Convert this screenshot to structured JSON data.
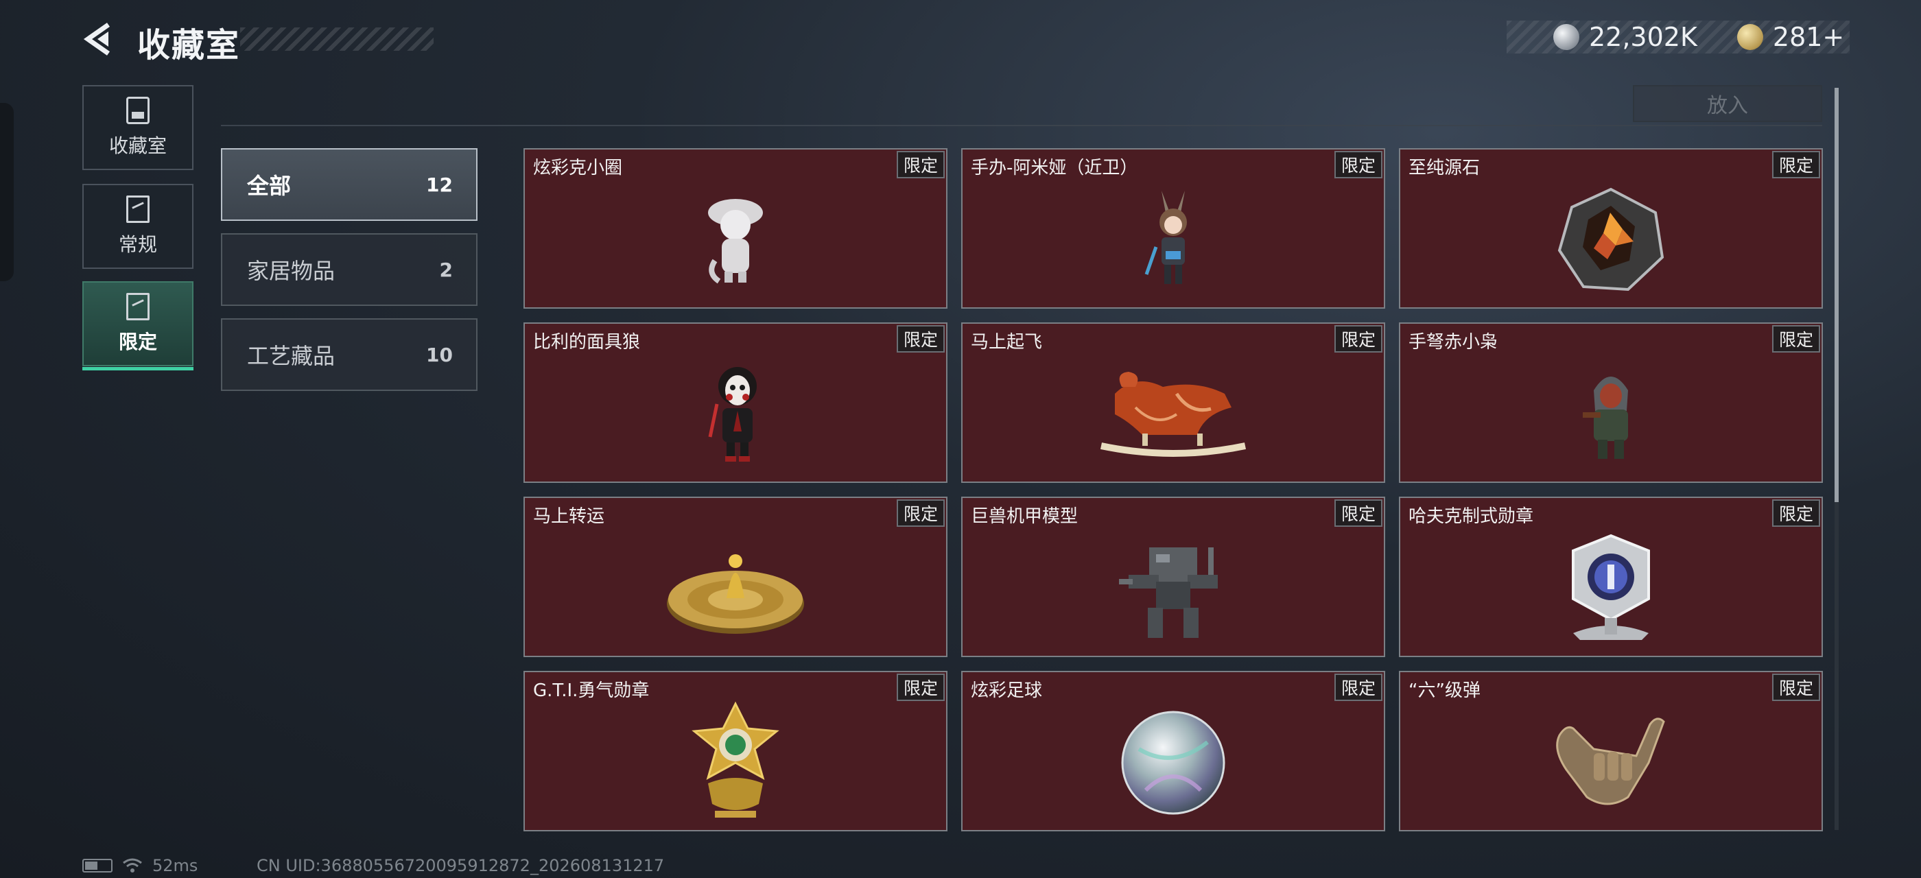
{
  "header": {
    "title": "收藏室",
    "currency_silver": "22,302K",
    "currency_gold": "281+"
  },
  "side_nav": [
    {
      "label": "收藏室",
      "icon": "collection-cabinet-icon",
      "active": false
    },
    {
      "label": "常规",
      "icon": "regular-frame-icon",
      "active": false
    },
    {
      "label": "限定",
      "icon": "limited-frame-icon",
      "active": true
    }
  ],
  "toolbar": {
    "place_button_label": "放入"
  },
  "categories": [
    {
      "label": "全部",
      "count": "12",
      "active": true
    },
    {
      "label": "家居物品",
      "count": "2",
      "active": false
    },
    {
      "label": "工艺藏品",
      "count": "10",
      "active": false
    }
  ],
  "items": [
    {
      "name": "炫彩克小圈",
      "badge": "限定",
      "icon": "figurine-icon"
    },
    {
      "name": "手办-阿米娅（近卫）",
      "badge": "限定",
      "icon": "anime-figure-icon"
    },
    {
      "name": "至纯源石",
      "badge": "限定",
      "icon": "gem-icon"
    },
    {
      "name": "比利的面具狼",
      "badge": "限定",
      "icon": "mask-puppet-icon"
    },
    {
      "name": "马上起飞",
      "badge": "限定",
      "icon": "rocking-horse-icon"
    },
    {
      "name": "手弩赤小枭",
      "badge": "限定",
      "icon": "hooded-figure-icon"
    },
    {
      "name": "马上转运",
      "badge": "限定",
      "icon": "golden-disc-icon"
    },
    {
      "name": "巨兽机甲模型",
      "badge": "限定",
      "icon": "mech-model-icon"
    },
    {
      "name": "哈夫克制式勋章",
      "badge": "限定",
      "icon": "medal-shield-icon"
    },
    {
      "name": "G.T.I.勇气勋章",
      "badge": "限定",
      "icon": "star-medal-icon"
    },
    {
      "name": "炫彩足球",
      "badge": "限定",
      "icon": "iridescent-ball-icon"
    },
    {
      "name": "“六”级弹",
      "badge": "限定",
      "icon": "shaka-hand-icon"
    }
  ],
  "status_bar": {
    "ping": "52ms",
    "uid": "CN UID:36880556720095912872_202608131217"
  },
  "colors": {
    "card_bg": "#4a1c22",
    "accent_green": "#3fd1a4",
    "page_bg": "#1c222a"
  }
}
